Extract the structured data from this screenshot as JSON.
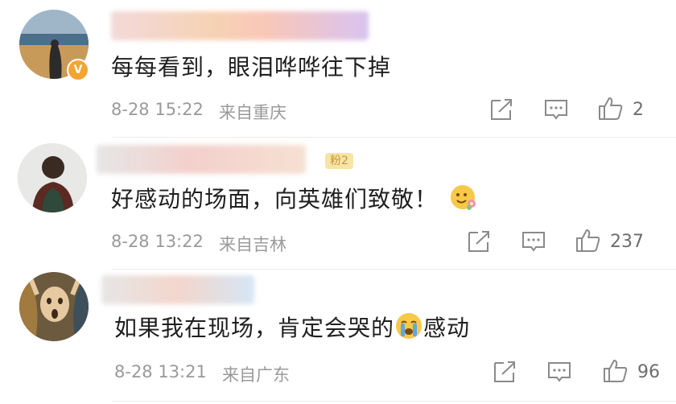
{
  "comments": [
    {
      "text": "每每看到，眼泪哗哗往下掉",
      "time": "8-28 15:22",
      "location": "来自重庆",
      "likes": "2",
      "verified_mark": "V"
    },
    {
      "text": "好感动的场面，向英雄们致敬！",
      "time": "8-28 13:22",
      "location": "来自吉林",
      "likes": "237",
      "fan_badge": "粉2"
    },
    {
      "text": "如果我在现场，肯定会哭的",
      "text_after": "感动",
      "time": "8-28 13:21",
      "location": "来自广东",
      "likes": "96"
    }
  ],
  "icons": {
    "share": "share-icon",
    "comment": "comment-icon",
    "like": "thumbs-up-icon",
    "emoji_flower": "flower-smile-emoji",
    "emoji_cry": "crying-emoji"
  },
  "colors": {
    "meta_text": "#9a9a9a",
    "verified": "#f2a531",
    "divider": "#ececec"
  }
}
